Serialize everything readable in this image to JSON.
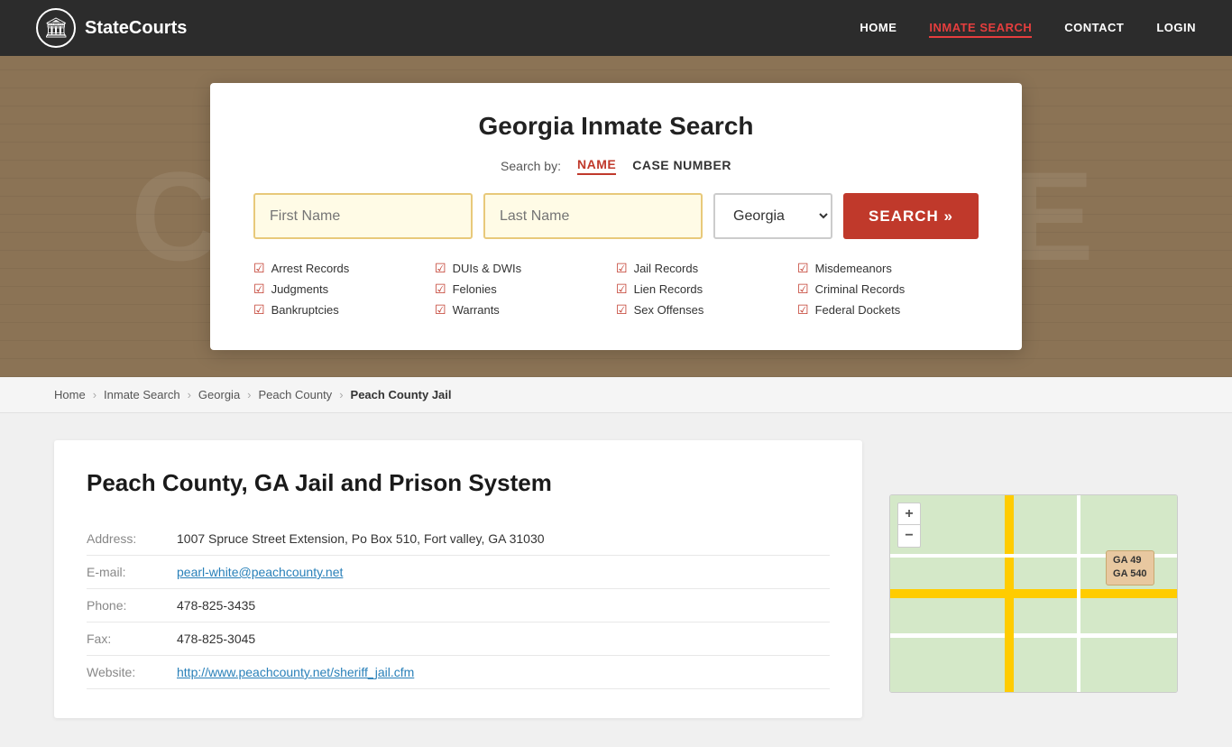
{
  "nav": {
    "logo_text": "StateCourts",
    "links": [
      {
        "label": "HOME",
        "active": false
      },
      {
        "label": "INMATE SEARCH",
        "active": true
      },
      {
        "label": "CONTACT",
        "active": false
      },
      {
        "label": "LOGIN",
        "active": false
      }
    ]
  },
  "search_card": {
    "title": "Georgia Inmate Search",
    "search_by_label": "Search by:",
    "tab_name": "NAME",
    "tab_case": "CASE NUMBER",
    "first_name_placeholder": "First Name",
    "last_name_placeholder": "Last Name",
    "state_value": "Georgia",
    "search_btn_label": "SEARCH »",
    "checkboxes": [
      "Arrest Records",
      "Judgments",
      "Bankruptcies",
      "DUIs & DWIs",
      "Felonies",
      "Warrants",
      "Jail Records",
      "Lien Records",
      "Sex Offenses",
      "Misdemeanors",
      "Criminal Records",
      "Federal Dockets"
    ]
  },
  "breadcrumb": {
    "items": [
      "Home",
      "Inmate Search",
      "Georgia",
      "Peach County",
      "Peach County Jail"
    ]
  },
  "facility": {
    "title": "Peach County, GA Jail and Prison System",
    "address_label": "Address:",
    "address_value": "1007 Spruce Street Extension, Po Box 510, Fort valley, GA 31030",
    "email_label": "E-mail:",
    "email_value": "pearl-white@peachcounty.net",
    "phone_label": "Phone:",
    "phone_value": "478-825-3435",
    "fax_label": "Fax:",
    "fax_value": "478-825-3045",
    "website_label": "Website:",
    "website_value": "http://www.peachcounty.net/sheriff_jail.cfm"
  },
  "map": {
    "badge_line1": "GA 49",
    "badge_line2": "GA 540",
    "zoom_in": "+",
    "zoom_out": "−"
  }
}
